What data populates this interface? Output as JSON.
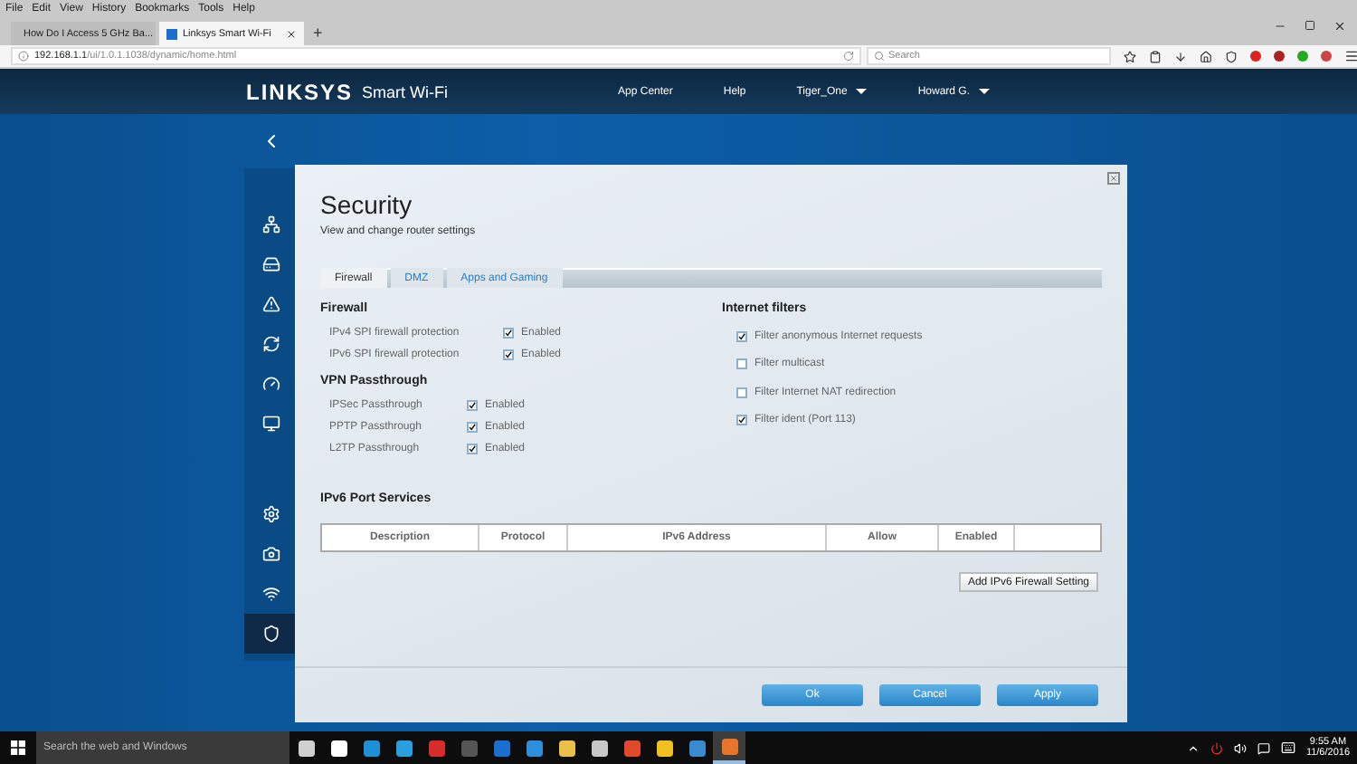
{
  "browser": {
    "menu": [
      "File",
      "Edit",
      "View",
      "History",
      "Bookmarks",
      "Tools",
      "Help"
    ],
    "tabs": [
      {
        "title": "How Do I Access 5 GHz Ba...",
        "selected": false
      },
      {
        "title": "Linksys Smart Wi-Fi",
        "selected": true
      }
    ],
    "new_tab": "+",
    "url_host": "192.168.1.1",
    "url_path": "/ui/1.0.1.1038/dynamic/home.html",
    "search_placeholder": "Search"
  },
  "header": {
    "logo": "LINKSYS",
    "product": "Smart Wi-Fi",
    "nav": [
      {
        "label": "App Center",
        "dropdown": false
      },
      {
        "label": "Help",
        "dropdown": false
      },
      {
        "label": "Tiger_One",
        "dropdown": true
      },
      {
        "label": "Howard G.",
        "dropdown": true
      }
    ]
  },
  "sidebar": {
    "top_items": [
      {
        "kind": "network",
        "selected": false
      },
      {
        "kind": "storage",
        "selected": false
      },
      {
        "kind": "alert",
        "selected": false
      },
      {
        "kind": "update",
        "selected": false
      },
      {
        "kind": "speed",
        "selected": false
      },
      {
        "kind": "connectivity",
        "selected": false
      }
    ],
    "bottom_items": [
      {
        "kind": "settings",
        "selected": false
      },
      {
        "kind": "camera",
        "selected": false
      },
      {
        "kind": "wireless",
        "selected": false
      },
      {
        "kind": "security",
        "selected": true
      }
    ]
  },
  "dialog": {
    "title": "Security",
    "subtitle": "View and change router settings",
    "tabs": [
      {
        "label": "Firewall",
        "selected": true
      },
      {
        "label": "DMZ",
        "selected": false
      },
      {
        "label": "Apps and Gaming",
        "selected": false
      }
    ],
    "firewall": {
      "heading": "Firewall",
      "rows": [
        {
          "label": "IPv4 SPI firewall protection",
          "option": "Enabled",
          "checked": true
        },
        {
          "label": "IPv6 SPI firewall protection",
          "option": "Enabled",
          "checked": true
        }
      ]
    },
    "vpn": {
      "heading": "VPN Passthrough",
      "rows": [
        {
          "label": "IPSec Passthrough",
          "option": "Enabled",
          "checked": true
        },
        {
          "label": "PPTP Passthrough",
          "option": "Enabled",
          "checked": true
        },
        {
          "label": "L2TP Passthrough",
          "option": "Enabled",
          "checked": true
        }
      ]
    },
    "filters": {
      "heading": "Internet filters",
      "items": [
        {
          "label": "Filter anonymous Internet requests",
          "checked": true
        },
        {
          "label": "Filter multicast",
          "checked": false
        },
        {
          "label": "Filter Internet NAT redirection",
          "checked": false
        },
        {
          "label": "Filter ident (Port 113)",
          "checked": true
        }
      ]
    },
    "ipv6": {
      "heading": "IPv6 Port Services",
      "columns": [
        "Description",
        "Protocol",
        "IPv6 Address",
        "Allow",
        "Enabled"
      ],
      "add_button": "Add IPv6 Firewall Setting"
    },
    "buttons": [
      "Ok",
      "Cancel",
      "Apply"
    ]
  },
  "taskbar": {
    "search_placeholder": "Search the web and Windows",
    "apps": [
      {
        "color": "#d0d0d0",
        "selected": false
      },
      {
        "color": "#ffffff",
        "selected": false
      },
      {
        "color": "#1e90d6",
        "selected": false
      },
      {
        "color": "#2a9fe0",
        "selected": false
      },
      {
        "color": "#d62c2c",
        "selected": false
      },
      {
        "color": "#555555",
        "selected": false
      },
      {
        "color": "#1a6fd0",
        "selected": false
      },
      {
        "color": "#2d8fdc",
        "selected": false
      },
      {
        "color": "#e8c04a",
        "selected": false
      },
      {
        "color": "#c8c8c8",
        "selected": false
      },
      {
        "color": "#e04a2a",
        "selected": false
      },
      {
        "color": "#f0c020",
        "selected": false
      },
      {
        "color": "#3a8ad0",
        "selected": false
      },
      {
        "color": "#e8762a",
        "selected": true
      }
    ],
    "time": "9:55 AM",
    "date": "11/6/2016"
  }
}
